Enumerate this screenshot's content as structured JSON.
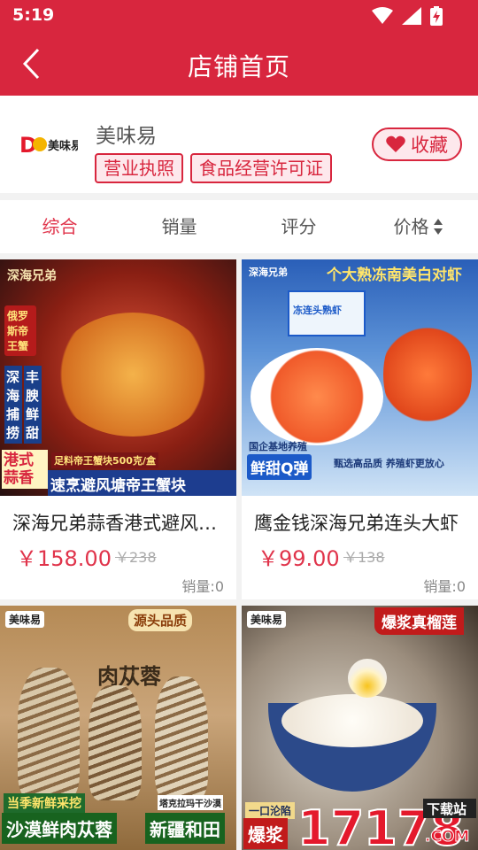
{
  "status_bar": {
    "time": "5:19",
    "icons": [
      "wifi-icon",
      "signal-icon",
      "battery-charging-icon"
    ]
  },
  "header": {
    "title": "店铺首页",
    "back_icon": "chevron-left-icon"
  },
  "shop": {
    "name": "美味易",
    "logo_text": "美味易",
    "tags": [
      "营业执照",
      "食品经营许可证"
    ],
    "favorite_label": "收藏"
  },
  "sort_tabs": [
    {
      "label": "综合",
      "active": true
    },
    {
      "label": "销量",
      "active": false
    },
    {
      "label": "评分",
      "active": false
    },
    {
      "label": "价格",
      "active": false
    }
  ],
  "products": [
    {
      "title": "深海兄弟蒜香港式避风塘帝王蟹块",
      "price": "￥158.00",
      "original_price": "￥238",
      "sales": "销量:0",
      "image_texts": [
        "深海兄弟",
        "俄罗斯帝王蟹",
        "深海捕捞",
        "丰腴鲜甜",
        "港式蒜香",
        "足料帝王蟹块500克/盒",
        "速烹避风塘帝王蟹块"
      ]
    },
    {
      "title": "鹰金钱深海兄弟连头大虾",
      "price": "￥99.00",
      "original_price": "￥138",
      "sales": "销量:0",
      "image_texts": [
        "深海兄弟",
        "个大熟冻南美白对虾",
        "冻连头熟虾",
        "国企基地养殖",
        "鲜甜Q弹",
        "甄选高品质 养殖虾更放心"
      ]
    },
    {
      "title": "",
      "image_texts": [
        "美味易",
        "源头品质",
        "肉苁蓉",
        "当季新鲜采挖",
        "塔克拉玛干沙漠",
        "沙漠鲜肉苁蓉",
        "新疆和田"
      ]
    },
    {
      "title": "",
      "image_texts": [
        "美味易",
        "爆浆真榴莲",
        "一口沦陷",
        "爆浆"
      ]
    }
  ],
  "watermark": {
    "number": "17178",
    "label": "下载站",
    "suffix": ".COM"
  },
  "colors": {
    "primary": "#d8263e",
    "price": "#e0344b",
    "tag_bg": "#fde8ec"
  }
}
